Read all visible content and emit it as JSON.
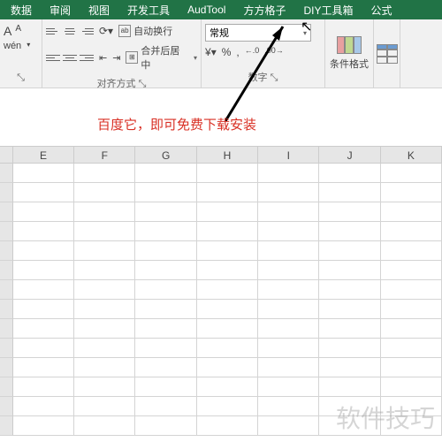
{
  "menu": {
    "items": [
      "数据",
      "审阅",
      "视图",
      "开发工具",
      "AudTool",
      "方方格子",
      "DIY工具箱",
      "公式"
    ]
  },
  "ribbon": {
    "font": {
      "a_big": "A",
      "a_small": "A",
      "wen": "wén",
      "arrow": "▾"
    },
    "align": {
      "wrap_label": "自动换行",
      "merge_label": "合并后居中",
      "group_label": "对齐方式"
    },
    "number": {
      "format": "常规",
      "currency": "¥",
      "percent": "%",
      "comma": ",",
      "inc": "←.0",
      "dec": ".00→",
      "group_label": "数字"
    },
    "cond": {
      "label": "条件格式"
    },
    "table": {
      "label": "表"
    }
  },
  "annotation": "百度它，即可免费下载安装",
  "columns": [
    "",
    "E",
    "F",
    "G",
    "H",
    "I",
    "J",
    "K"
  ],
  "watermark": "软件技巧"
}
